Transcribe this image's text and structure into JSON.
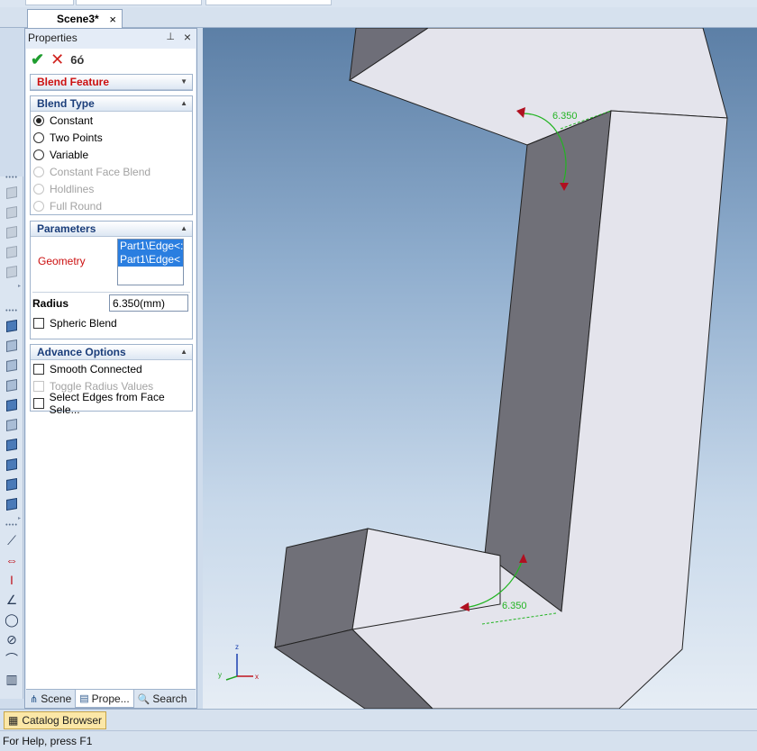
{
  "document_tab": {
    "title": "Scene3*",
    "close_glyph": "×"
  },
  "properties": {
    "title": "Properties",
    "pin_glyph": "⊥",
    "close_glyph": "×",
    "actions": {
      "ok_glyph": "✔",
      "cancel_glyph": "✕",
      "preview_glyph": "👓"
    },
    "feature_title": "Blend Feature",
    "blend_type": {
      "header": "Blend Type",
      "options": [
        {
          "label": "Constant",
          "selected": true,
          "enabled": true
        },
        {
          "label": "Two Points",
          "selected": false,
          "enabled": true
        },
        {
          "label": "Variable",
          "selected": false,
          "enabled": true
        },
        {
          "label": "Constant Face Blend",
          "selected": false,
          "enabled": false
        },
        {
          "label": "Holdlines",
          "selected": false,
          "enabled": false
        },
        {
          "label": "Full Round",
          "selected": false,
          "enabled": false
        }
      ]
    },
    "parameters": {
      "header": "Parameters",
      "geometry_label": "Geometry",
      "geometry_items": [
        "Part1\\Edge<:",
        "Part1\\Edge<"
      ],
      "radius_label": "Radius",
      "radius_value": "6.350(mm)",
      "spheric_blend_label": "Spheric Blend"
    },
    "advance_options": {
      "header": "Advance Options",
      "smooth_connected": "Smooth Connected",
      "toggle_radius": "Toggle Radius Values",
      "select_edges": "Select Edges from Face Sele..."
    },
    "bottom_tabs": [
      {
        "label": "Scene",
        "icon": "scene-icon"
      },
      {
        "label": "Prope...",
        "icon": "properties-icon"
      },
      {
        "label": "Search",
        "icon": "search-icon"
      }
    ]
  },
  "viewport": {
    "dimension_labels": [
      "6.350",
      "6.350"
    ],
    "axes": {
      "z": "z",
      "y": "y",
      "x": "x"
    },
    "colors": {
      "dimension": "#22b422",
      "face_light": "#e4e4ec",
      "face_dark": "#707078"
    }
  },
  "catalog_button": "Catalog Browser",
  "status_text": "For Help, press F1"
}
